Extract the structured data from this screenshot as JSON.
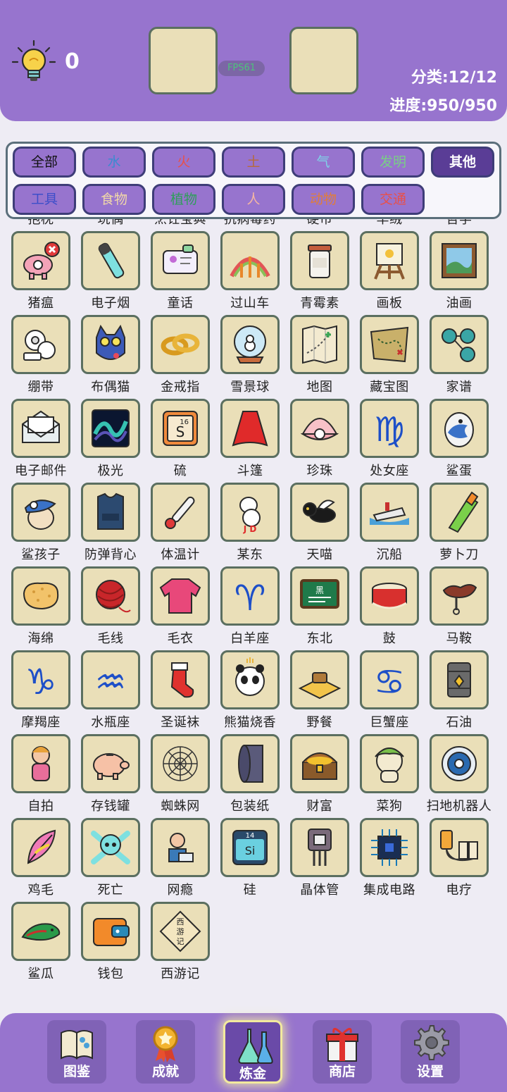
{
  "header": {
    "hint_count": "0",
    "fps": "FPS61",
    "category_text": "分类:12/12",
    "progress_text": "进度:950/950"
  },
  "filters": [
    {
      "label": "全部",
      "color": "#111111",
      "active": false
    },
    {
      "label": "水",
      "color": "#3a8bd0",
      "active": false
    },
    {
      "label": "火",
      "color": "#e8504a",
      "active": false
    },
    {
      "label": "土",
      "color": "#b66a3c",
      "active": false
    },
    {
      "label": "气",
      "color": "#7fd4e8",
      "active": false
    },
    {
      "label": "发明",
      "color": "#79cf86",
      "active": false
    },
    {
      "label": "其他",
      "color": "#ffffff",
      "active": true
    },
    {
      "label": "工具",
      "color": "#3d4ec9",
      "active": false
    },
    {
      "label": "食物",
      "color": "#f1d8a8",
      "active": false
    },
    {
      "label": "植物",
      "color": "#2f9e5a",
      "active": false
    },
    {
      "label": "人",
      "color": "#f5b6a2",
      "active": false
    },
    {
      "label": "动物",
      "color": "#e07d3a",
      "active": false
    },
    {
      "label": "交通",
      "color": "#e8504a",
      "active": false
    }
  ],
  "items": [
    {
      "label": "抱枕",
      "icon": "pillow-icon"
    },
    {
      "label": "玩偶",
      "icon": "doll-icon"
    },
    {
      "label": "烹饪宝典",
      "icon": "cookbook-icon"
    },
    {
      "label": "抗病毒药",
      "icon": "medicine-icon"
    },
    {
      "label": "硬币",
      "icon": "coin-icon"
    },
    {
      "label": "羊绒",
      "icon": "wool-icon"
    },
    {
      "label": "哲学",
      "icon": "philosophy-icon"
    },
    {
      "label": "猪瘟",
      "icon": "swine-fever-icon"
    },
    {
      "label": "电子烟",
      "icon": "e-cigarette-icon"
    },
    {
      "label": "童话",
      "icon": "fairy-tale-icon"
    },
    {
      "label": "过山车",
      "icon": "roller-coaster-icon"
    },
    {
      "label": "青霉素",
      "icon": "penicillin-icon"
    },
    {
      "label": "画板",
      "icon": "easel-icon"
    },
    {
      "label": "油画",
      "icon": "oil-painting-icon"
    },
    {
      "label": "绷带",
      "icon": "bandage-icon"
    },
    {
      "label": "布偶猫",
      "icon": "ragdoll-cat-icon"
    },
    {
      "label": "金戒指",
      "icon": "gold-ring-icon"
    },
    {
      "label": "雪景球",
      "icon": "snow-globe-icon"
    },
    {
      "label": "地图",
      "icon": "map-icon"
    },
    {
      "label": "藏宝图",
      "icon": "treasure-map-icon"
    },
    {
      "label": "家谱",
      "icon": "family-tree-icon"
    },
    {
      "label": "电子邮件",
      "icon": "email-icon"
    },
    {
      "label": "极光",
      "icon": "aurora-icon"
    },
    {
      "label": "硫",
      "icon": "sulfur-icon"
    },
    {
      "label": "斗篷",
      "icon": "cape-icon"
    },
    {
      "label": "珍珠",
      "icon": "pearl-icon"
    },
    {
      "label": "处女座",
      "icon": "virgo-icon"
    },
    {
      "label": "鲨蛋",
      "icon": "shark-egg-icon"
    },
    {
      "label": "鲨孩子",
      "icon": "shark-kid-icon"
    },
    {
      "label": "防弹背心",
      "icon": "bulletproof-vest-icon"
    },
    {
      "label": "体温计",
      "icon": "thermometer-icon"
    },
    {
      "label": "某东",
      "icon": "jd-dog-icon"
    },
    {
      "label": "天喵",
      "icon": "flying-cat-icon"
    },
    {
      "label": "沉船",
      "icon": "shipwreck-icon"
    },
    {
      "label": "萝卜刀",
      "icon": "carrot-knife-icon"
    },
    {
      "label": "海绵",
      "icon": "sponge-icon"
    },
    {
      "label": "毛线",
      "icon": "yarn-icon"
    },
    {
      "label": "毛衣",
      "icon": "sweater-icon"
    },
    {
      "label": "白羊座",
      "icon": "aries-icon"
    },
    {
      "label": "东北",
      "icon": "blackboard-icon"
    },
    {
      "label": "鼓",
      "icon": "drum-icon"
    },
    {
      "label": "马鞍",
      "icon": "saddle-icon"
    },
    {
      "label": "摩羯座",
      "icon": "capricorn-icon"
    },
    {
      "label": "水瓶座",
      "icon": "aquarius-icon"
    },
    {
      "label": "圣诞袜",
      "icon": "christmas-stocking-icon"
    },
    {
      "label": "熊猫烧香",
      "icon": "panda-incense-icon"
    },
    {
      "label": "野餐",
      "icon": "picnic-icon"
    },
    {
      "label": "巨蟹座",
      "icon": "cancer-icon"
    },
    {
      "label": "石油",
      "icon": "oil-barrel-icon"
    },
    {
      "label": "自拍",
      "icon": "selfie-icon"
    },
    {
      "label": "存钱罐",
      "icon": "piggy-bank-icon"
    },
    {
      "label": "蜘蛛网",
      "icon": "spider-web-icon"
    },
    {
      "label": "包装纸",
      "icon": "wrapping-paper-icon"
    },
    {
      "label": "财富",
      "icon": "treasure-chest-icon"
    },
    {
      "label": "菜狗",
      "icon": "veggie-dog-icon"
    },
    {
      "label": "扫地机器人",
      "icon": "robot-vacuum-icon"
    },
    {
      "label": "鸡毛",
      "icon": "feather-icon"
    },
    {
      "label": "死亡",
      "icon": "skull-icon"
    },
    {
      "label": "网瘾",
      "icon": "internet-addict-icon"
    },
    {
      "label": "硅",
      "icon": "silicon-icon"
    },
    {
      "label": "晶体管",
      "icon": "transistor-icon"
    },
    {
      "label": "集成电路",
      "icon": "chip-icon"
    },
    {
      "label": "电疗",
      "icon": "electrotherapy-icon"
    },
    {
      "label": "鲨瓜",
      "icon": "shark-melon-icon"
    },
    {
      "label": "钱包",
      "icon": "wallet-icon"
    },
    {
      "label": "西游记",
      "icon": "journey-west-icon"
    }
  ],
  "tile_texts": {
    "sulfur_number": "16",
    "sulfur_symbol": "S",
    "silicon_number": "14",
    "silicon_symbol": "Si",
    "blackboard_char": "黑",
    "jd_text": "J D",
    "book_chars": [
      "西",
      "游",
      "记"
    ]
  },
  "nav": [
    {
      "label": "图鉴",
      "icon": "book-icon",
      "active": false
    },
    {
      "label": "成就",
      "icon": "medal-icon",
      "active": false
    },
    {
      "label": "炼金",
      "icon": "flask-icon",
      "active": true
    },
    {
      "label": "商店",
      "icon": "gift-icon",
      "active": false
    },
    {
      "label": "设置",
      "icon": "gear-icon",
      "active": false
    }
  ]
}
